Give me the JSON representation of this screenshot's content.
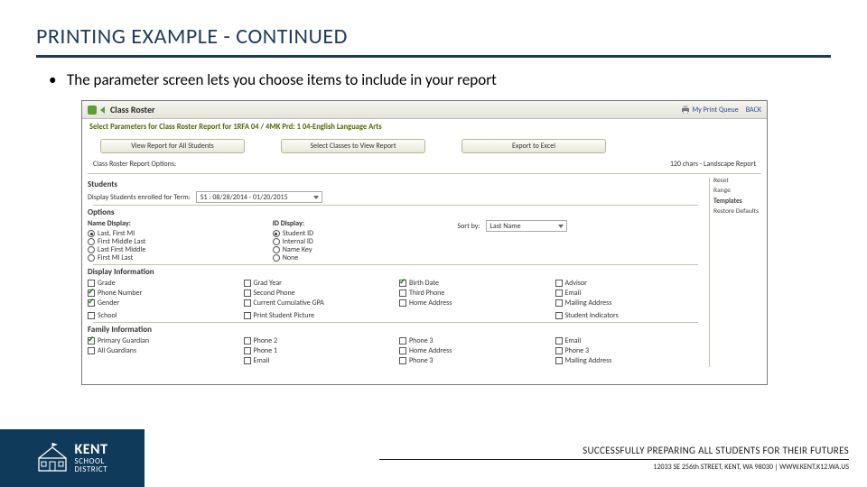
{
  "title": "PRINTING EXAMPLE - CONTINUED",
  "bullet": "The parameter screen lets you choose items to include in your report",
  "panel": {
    "window_title": "Class Roster",
    "print_queue": "My Print Queue",
    "back": "BACK",
    "subtitle": "Select Parameters for Class Roster Report for 1RFA 04 / 4MK Prd: 1 04-English Language Arts",
    "buttons": {
      "b1": "View Report for All Students",
      "b2": "Select Classes to View Report",
      "b3": "Export to Excel"
    },
    "meta_left": "Class Roster Report Options:",
    "meta_right": "120 chars - Landscape Report",
    "students_h": "Students",
    "display_label": "Display Students enrolled for Term:",
    "term_select": "S1 : 08/28/2014 - 01/20/2015",
    "options_h": "Options",
    "name_h": "Name Display:",
    "id_h": "ID Display:",
    "sort_label": "Sort by:",
    "sort_select": "Last Name",
    "name_opts": [
      "Last, First MI",
      "First Middle Last",
      "Last First Middle",
      "First MI Last"
    ],
    "id_opts": [
      "Student ID",
      "Internal ID",
      "Name Key",
      "None"
    ],
    "dispinfo_h": "Display Information",
    "di": [
      "Grade",
      "Phone Number",
      "Gender",
      "Grad Year",
      "Second Phone",
      "Current Cumulative GPA",
      "Birth Date",
      "Third Phone",
      "Home Address",
      "Advisor",
      "Email",
      "Mailing Address"
    ],
    "di2a": "School",
    "di2b": "Print Student Picture",
    "di2c": "Student Indicators",
    "family_h": "Family Information",
    "fam": [
      "Primary Guardian",
      "All Guardians",
      "Phone 2",
      "Phone 1",
      "Email",
      "Phone 3",
      "Home Address",
      "Phone 3",
      "Email",
      "Phone 3",
      "Mailing Address"
    ],
    "side": {
      "r1": "Reset",
      "r2": "Range",
      "r3": "Templates",
      "r4": "Restore Defaults"
    }
  },
  "footer": {
    "brand1": "KENT",
    "brand2": "SCHOOL",
    "brand3": "DISTRICT",
    "tagline": "SUCCESSFULLY PREPARING ALL STUDENTS FOR THEIR FUTURES",
    "address": "12033 SE 256th STREET, KENT, WA 98030   |   WWW.KENT.K12.WA.US"
  }
}
